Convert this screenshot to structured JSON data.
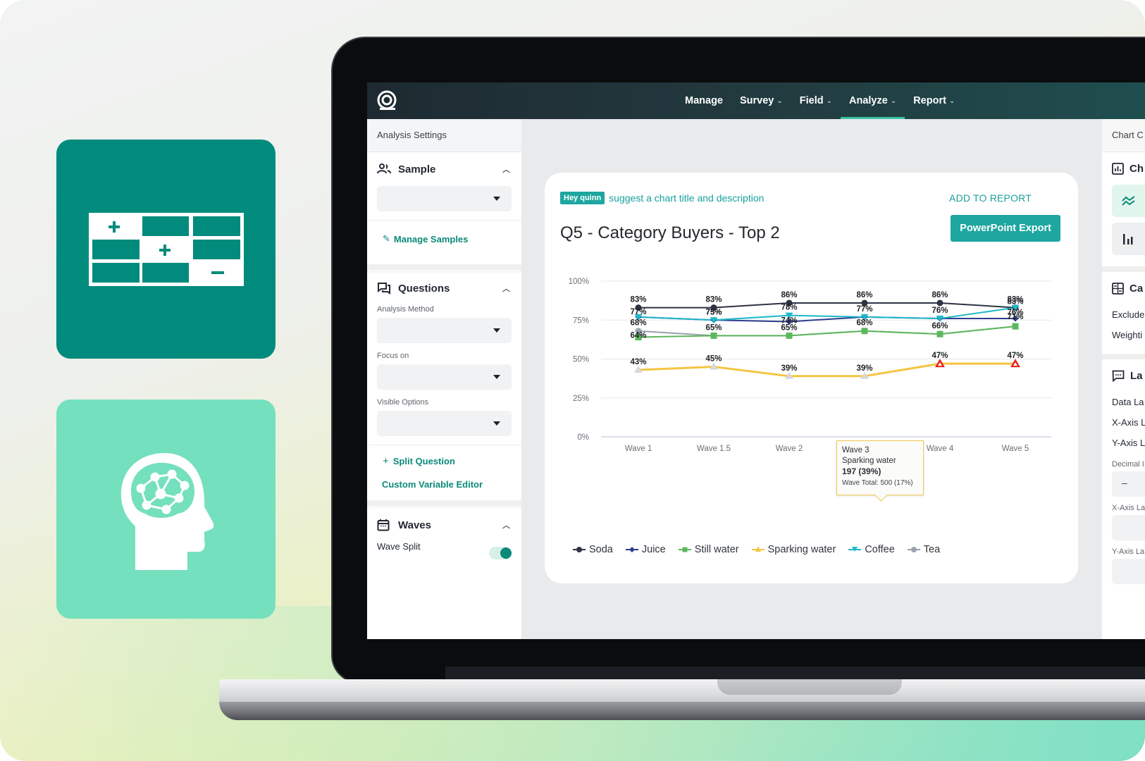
{
  "nav": {
    "items": [
      {
        "label": "Manage",
        "has_dropdown": false,
        "active": false
      },
      {
        "label": "Survey",
        "has_dropdown": true,
        "active": false
      },
      {
        "label": "Field",
        "has_dropdown": true,
        "active": false
      },
      {
        "label": "Analyze",
        "has_dropdown": true,
        "active": true
      },
      {
        "label": "Report",
        "has_dropdown": true,
        "active": false
      }
    ],
    "chevron": "⌄"
  },
  "left_panel": {
    "header": "Analysis Settings",
    "sample": {
      "title": "Sample",
      "select_value": "",
      "manage_samples": "Manage Samples"
    },
    "questions": {
      "title": "Questions",
      "analysis_method_label": "Analysis Method",
      "analysis_method_value": "",
      "focus_on_label": "Focus on",
      "focus_on_value": "",
      "visible_options_label": "Visible Options",
      "visible_options_value": "",
      "split_question": "Split Question",
      "custom_variable_editor": "Custom Variable Editor"
    },
    "waves": {
      "title": "Waves",
      "wave_split_label": "Wave Split",
      "wave_split_on": true
    }
  },
  "card": {
    "quinn_badge": "Hey quinn",
    "quinn_suggestion": "suggest a chart title and description",
    "add_to_report": "ADD TO REPORT",
    "ppt_export": "PowerPoint Export",
    "tooltip": {
      "wave": "Wave 3",
      "series": "Sparking water",
      "count_pct": "197 (39%)",
      "wave_total": "Wave Total: 500 (17%)"
    }
  },
  "right_panel": {
    "header": "Chart C",
    "chart_type_title": "Ch",
    "calc_title": "Ca",
    "calc_rows": [
      "Exclude",
      "Weighti"
    ],
    "labels_title": "La",
    "labels_rows": [
      "Data La",
      "X-Axis L",
      "Y-Axis L"
    ],
    "decimal_label": "Decimal I",
    "decimal_value": "–",
    "xaxis_label_label": "X-Axis La",
    "yaxis_label_label": "Y-Axis La"
  },
  "colors": {
    "brand_teal": "#008b7c",
    "accent": "#1ea6a0",
    "mint": "#74e0bd"
  },
  "chart_data": {
    "type": "line",
    "title": "Q5 - Category Buyers - Top 2",
    "xlabel": "",
    "ylabel": "",
    "x": [
      "Wave 1",
      "Wave 1.5",
      "Wave 2",
      "Wave 3",
      "Wave 4",
      "Wave 5"
    ],
    "yticks": [
      "0%",
      "25%",
      "50%",
      "75%",
      "100%"
    ],
    "ylim": [
      0,
      100
    ],
    "grid": true,
    "legend_position": "bottom-left",
    "series": [
      {
        "name": "Soda",
        "color": "#2e3344",
        "marker": "circle",
        "values": [
          83,
          83,
          86,
          86,
          86,
          83
        ]
      },
      {
        "name": "Juice",
        "color": "#2f3d8f",
        "marker": "diamond",
        "values": [
          77,
          75,
          74,
          77,
          76,
          76
        ]
      },
      {
        "name": "Still water",
        "color": "#5cb85c",
        "marker": "square",
        "values": [
          64,
          65,
          65,
          68,
          66,
          71
        ]
      },
      {
        "name": "Sparking water",
        "color": "#f5c542",
        "marker": "triangle",
        "values": [
          43,
          45,
          39,
          39,
          47,
          47
        ],
        "flagged_points": [
          4,
          5
        ]
      },
      {
        "name": "Coffee",
        "color": "#1fb8c8",
        "marker": "triangle-down",
        "values": [
          77,
          75,
          78,
          77,
          76,
          83
        ]
      },
      {
        "name": "Tea",
        "color": "#9aa2ad",
        "marker": "circle",
        "values": [
          68,
          65,
          65,
          68,
          66,
          71
        ]
      }
    ],
    "annotations": [
      {
        "type": "tooltip",
        "x": "Wave 3",
        "series": "Sparking water",
        "text": "197 (39%) — Wave Total: 500 (17%)"
      }
    ]
  }
}
